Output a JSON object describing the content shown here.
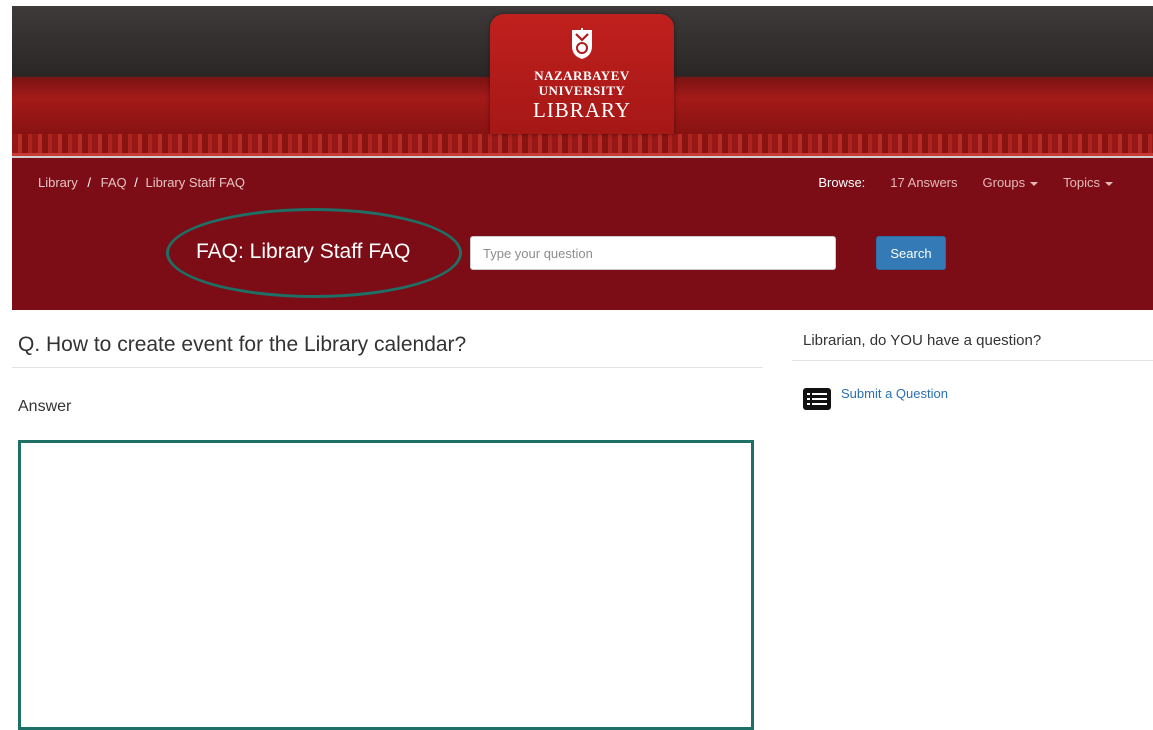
{
  "logo": {
    "line1": "NAZARBAYEV",
    "line2": "UNIVERSITY",
    "line3": "LIBRARY",
    "emblem_icon": "university-emblem-icon"
  },
  "breadcrumb": {
    "items": [
      "Library",
      "FAQ",
      "Library Staff FAQ"
    ],
    "separator": "/"
  },
  "browse": {
    "label": "Browse:",
    "answers": "17 Answers",
    "groups": "Groups",
    "topics": "Topics"
  },
  "faq": {
    "title": "FAQ: Library Staff FAQ"
  },
  "search": {
    "placeholder": "Type your question",
    "button": "Search"
  },
  "main": {
    "question": "Q. How to create event for the Library calendar?",
    "answer_label": "Answer"
  },
  "sidebar": {
    "title": "Librarian, do YOU have a question?",
    "submit_label": "Submit a Question",
    "submit_icon": "list-icon"
  },
  "colors": {
    "header_bar": "#7c0d16",
    "accent_annotation": "#1e7066",
    "button_blue": "#337ab7",
    "link_blue": "#2a6fb3"
  }
}
